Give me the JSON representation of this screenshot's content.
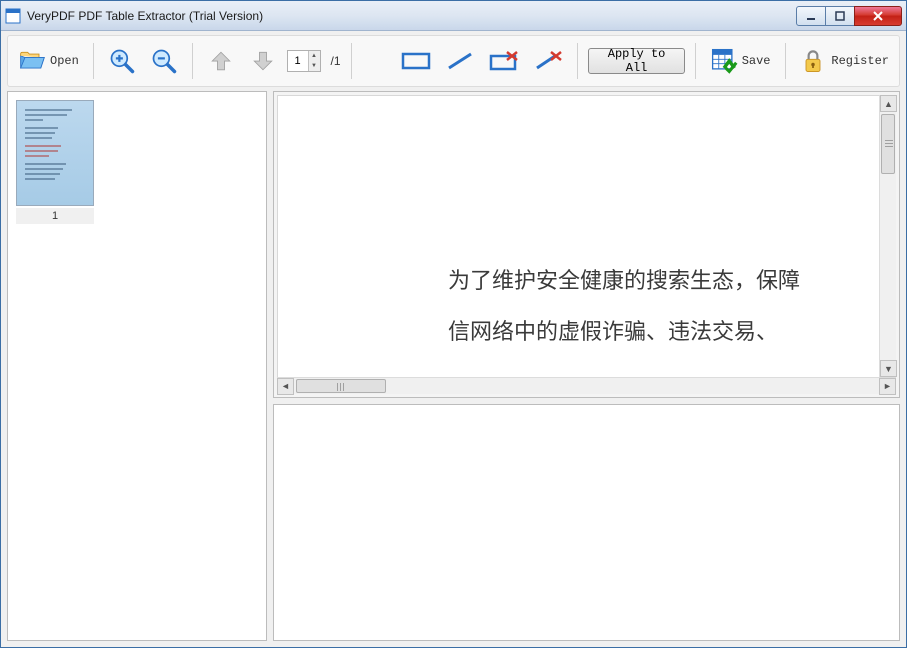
{
  "title": "VeryPDF PDF Table Extractor (Trial Version)",
  "toolbar": {
    "open_label": "Open",
    "page_value": "1",
    "page_total": "/1",
    "apply_label": "Apply to All",
    "save_label": "Save",
    "register_label": "Register"
  },
  "thumbnails": [
    {
      "label": "1"
    }
  ],
  "preview": {
    "line1": "为了维护安全健康的搜索生态，保障",
    "line2": "信网络中的虚假诈骗、违法交易、"
  },
  "colors": {
    "close": "#d43a2e",
    "accent": "#2a72c8"
  }
}
